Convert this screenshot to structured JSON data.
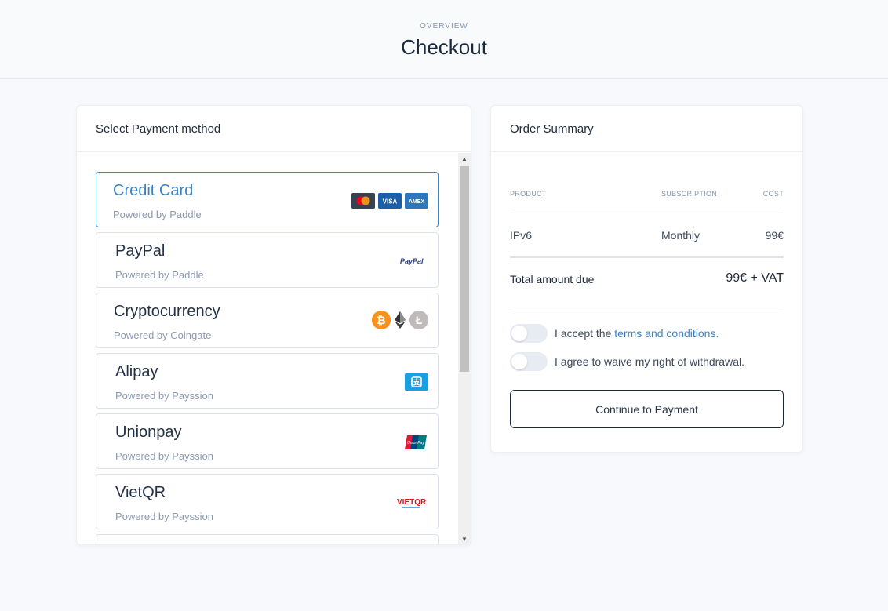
{
  "header": {
    "overline": "OVERVIEW",
    "title": "Checkout"
  },
  "payment": {
    "title": "Select Payment method",
    "methods": [
      {
        "name": "Credit Card",
        "provider": "Powered by Paddle",
        "selected": true,
        "logos": [
          "mastercard-icon",
          "visa-icon",
          "amex-icon"
        ]
      },
      {
        "name": "PayPal",
        "provider": "Powered by Paddle",
        "logos": [
          "paypal-icon"
        ]
      },
      {
        "name": "Cryptocurrency",
        "provider": "Powered by Coingate",
        "logos": [
          "bitcoin-icon",
          "ethereum-icon",
          "litecoin-icon"
        ]
      },
      {
        "name": "Alipay",
        "provider": "Powered by Payssion",
        "logos": [
          "alipay-icon"
        ]
      },
      {
        "name": "Unionpay",
        "provider": "Powered by Payssion",
        "logos": [
          "unionpay-icon"
        ]
      },
      {
        "name": "VietQR",
        "provider": "Powered by Payssion",
        "logos": [
          "vietqr-icon"
        ]
      }
    ],
    "logo_text": {
      "visa": "VISA",
      "amex": "AMEX",
      "paypal": "PayPal",
      "unionpay": "UnionPay",
      "vietqr": "VIETQR"
    }
  },
  "summary": {
    "title": "Order Summary",
    "columns": {
      "product": "PRODUCT",
      "subscription": "SUBSCRIPTION",
      "cost": "COST"
    },
    "row": {
      "product": "IPv6",
      "subscription": "Monthly",
      "cost": "99€"
    },
    "total_label": "Total amount due",
    "total_value": "99€ + VAT",
    "terms_prefix": "I accept the ",
    "terms_link": "terms and conditions.",
    "waive_label": "I agree to waive my right of withdrawal.",
    "continue_label": "Continue to Payment",
    "toggles": {
      "terms": false,
      "waive": false
    }
  },
  "colors": {
    "accent": "#3b82c4",
    "bitcoin": "#f7931a",
    "alipay": "#1a9fe0",
    "vietqr_red": "#d7141a"
  }
}
